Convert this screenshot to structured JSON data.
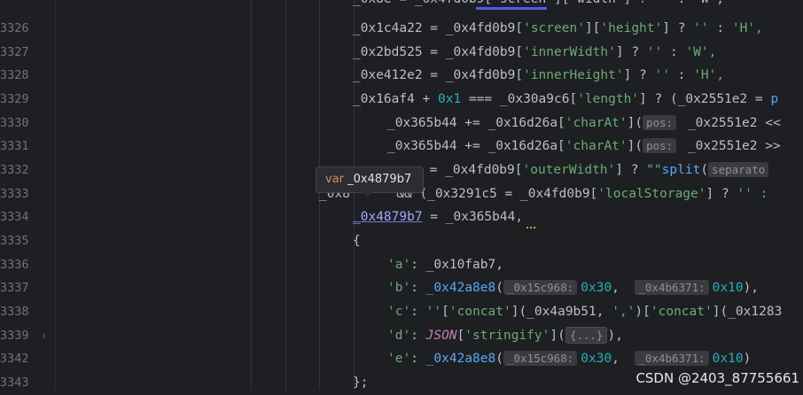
{
  "line_numbers": [
    "3326",
    "3327",
    "3328",
    "3329",
    "3330",
    "3331",
    "3332",
    "3333",
    "3334",
    "3335",
    "3336",
    "3337",
    "3338",
    "3339",
    "3342",
    "3343"
  ],
  "code": {
    "l3326": {
      "v": "_0x1c4a22",
      "eq": " = ",
      "obj": "_0x4fd0b9",
      "s1": "'screen'",
      "s2": "'height'",
      "rest": " ? ",
      "e": "''",
      " c": " : ",
      "r": "'H',"
    },
    "l3327": {
      "v": "_0x2bd525",
      "obj": "_0x4fd0b9",
      "s1": "'innerWidth'",
      "e": "''",
      "r": "'W',"
    },
    "l3328": {
      "v": "_0xe412e2",
      "obj": "_0x4fd0b9",
      "s1": "'innerHeight'",
      "e": "''",
      "r": "'H',"
    },
    "l3329": {
      "a": "_0x16af4 + ",
      "n": "0x1",
      "b": " === _0x30a9c6[",
      "s": "'length'",
      "c": "] ? (_0x2551e2 = ",
      "p": "p"
    },
    "l3330": {
      "a": "_0x365b44 += _0x16d26a[",
      "s": "'charAt'",
      "c": "](",
      "hint": "pos:",
      "d": " _0x2551e2 <<"
    },
    "l3331": {
      "a": "_0x365b44 += _0x16d26a[",
      "s": "'charAt'",
      "c": "](",
      "hint": "pos:",
      "d": " _0x2551e2 >>"
    },
    "l3332": {
      "a": " = _0x4fd0b9[",
      "s": "'outerWidth'",
      "c": "] ? ",
      "e": "\"\"",
      ".": ".",
      "f": "split",
      "p": "(",
      "hint": "separato"
    },
    "l3333": {
      "a": "_0x8",
      "b": " && (_0x3291c5 = _0x4fd0b9[",
      "s": "'localStorage'",
      "c": "] ? ",
      "e": "'' :"
    },
    "l3334": {
      "v": "_0x4879b7",
      "b": " = _0x365b44,"
    },
    "l3335": {
      "brace": "{"
    },
    "l3336": {
      "k": "'a'",
      "v": ": _0x10fab7,"
    },
    "l3337": {
      "k": "'b'",
      "f": "_0x42a8e8",
      "h1": "_0x15c968:",
      "n1": "0x30",
      "h2": "_0x4b6371:",
      "n2": "0x10",
      "end": "),"
    },
    "l3338": {
      "k": "'c'",
      "a": ": ",
      "e": "''",
      "b": "[",
      "s": "'concat'",
      "c": "](_0x4a9b51, ",
      "comma": "','",
      "d": ")[",
      "s2": "'concat'",
      "g": "](_0x1283"
    },
    "l3339": {
      "k": "'d'",
      "j": "JSON",
      "s": "'stringify'",
      "c": "(",
      "box": "{...}",
      "end": "),"
    },
    "l3342": {
      "k": "'e'",
      "f": "_0x42a8e8",
      "h1": "_0x15c968:",
      "n1": "0x30",
      "h2": "_0x4b6371:",
      "n2": "0x10",
      "end": ")"
    },
    "l3343": {
      "close": "};"
    }
  },
  "tooltip": {
    "kw": "var",
    "name": " _0x4879b7"
  },
  "watermark": "CSDN @2403_87755661",
  "colors": {
    "background": "#1e1f22",
    "string": "#6aab73",
    "number": "#2aacb8",
    "function": "#56a8f5",
    "keyword": "#cf8e6d"
  }
}
